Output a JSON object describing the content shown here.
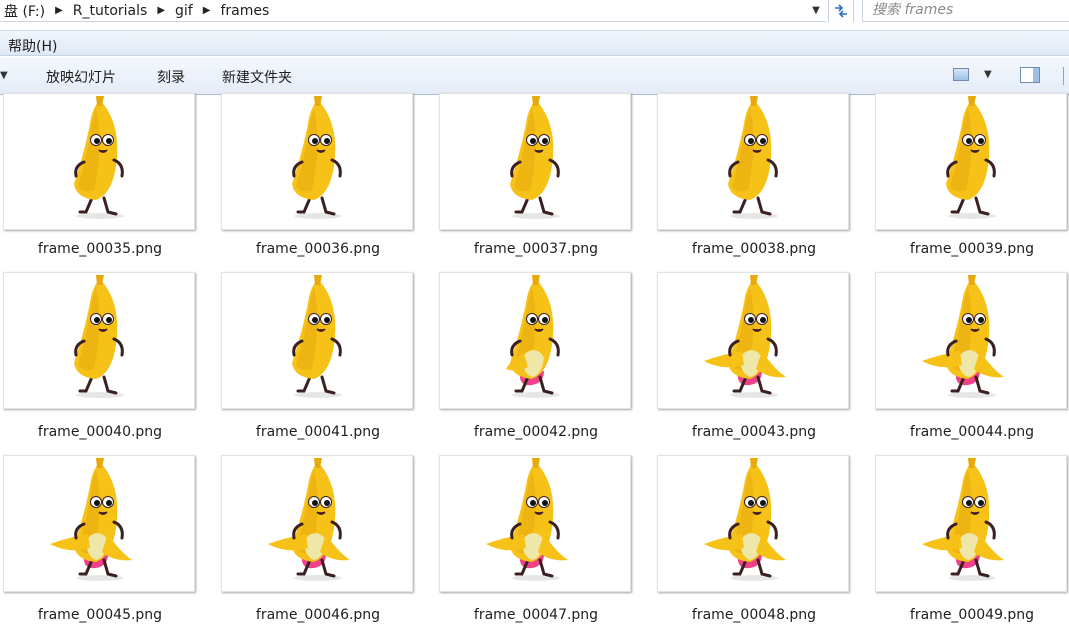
{
  "address_bar": {
    "crumbs": [
      "盘 (F:)",
      "R_tutorials",
      "gif",
      "frames"
    ],
    "search_placeholder": "搜索 frames"
  },
  "menu": {
    "help_label": "帮助(H)"
  },
  "toolbar": {
    "slideshow_label": "放映幻灯片",
    "burn_label": "刻录",
    "new_folder_label": "新建文件夹"
  },
  "files": [
    {
      "name": "frame_00035.png",
      "pose": "walk"
    },
    {
      "name": "frame_00036.png",
      "pose": "walk"
    },
    {
      "name": "frame_00037.png",
      "pose": "walk"
    },
    {
      "name": "frame_00038.png",
      "pose": "walk"
    },
    {
      "name": "frame_00039.png",
      "pose": "walk"
    },
    {
      "name": "frame_00040.png",
      "pose": "walk"
    },
    {
      "name": "frame_00041.png",
      "pose": "walk"
    },
    {
      "name": "frame_00042.png",
      "pose": "peel-start"
    },
    {
      "name": "frame_00043.png",
      "pose": "peeled"
    },
    {
      "name": "frame_00044.png",
      "pose": "peeled"
    },
    {
      "name": "frame_00045.png",
      "pose": "peeled"
    },
    {
      "name": "frame_00046.png",
      "pose": "peeled"
    },
    {
      "name": "frame_00047.png",
      "pose": "peeled"
    },
    {
      "name": "frame_00048.png",
      "pose": "peeled"
    },
    {
      "name": "frame_00049.png",
      "pose": "peeled"
    }
  ],
  "colors": {
    "banana": "#f6c218",
    "banana_shade": "#e8a90e",
    "banana_light": "#fde57a",
    "limb": "#3a2020",
    "shorts": "#f0418a",
    "flesh": "#efe7a8"
  }
}
